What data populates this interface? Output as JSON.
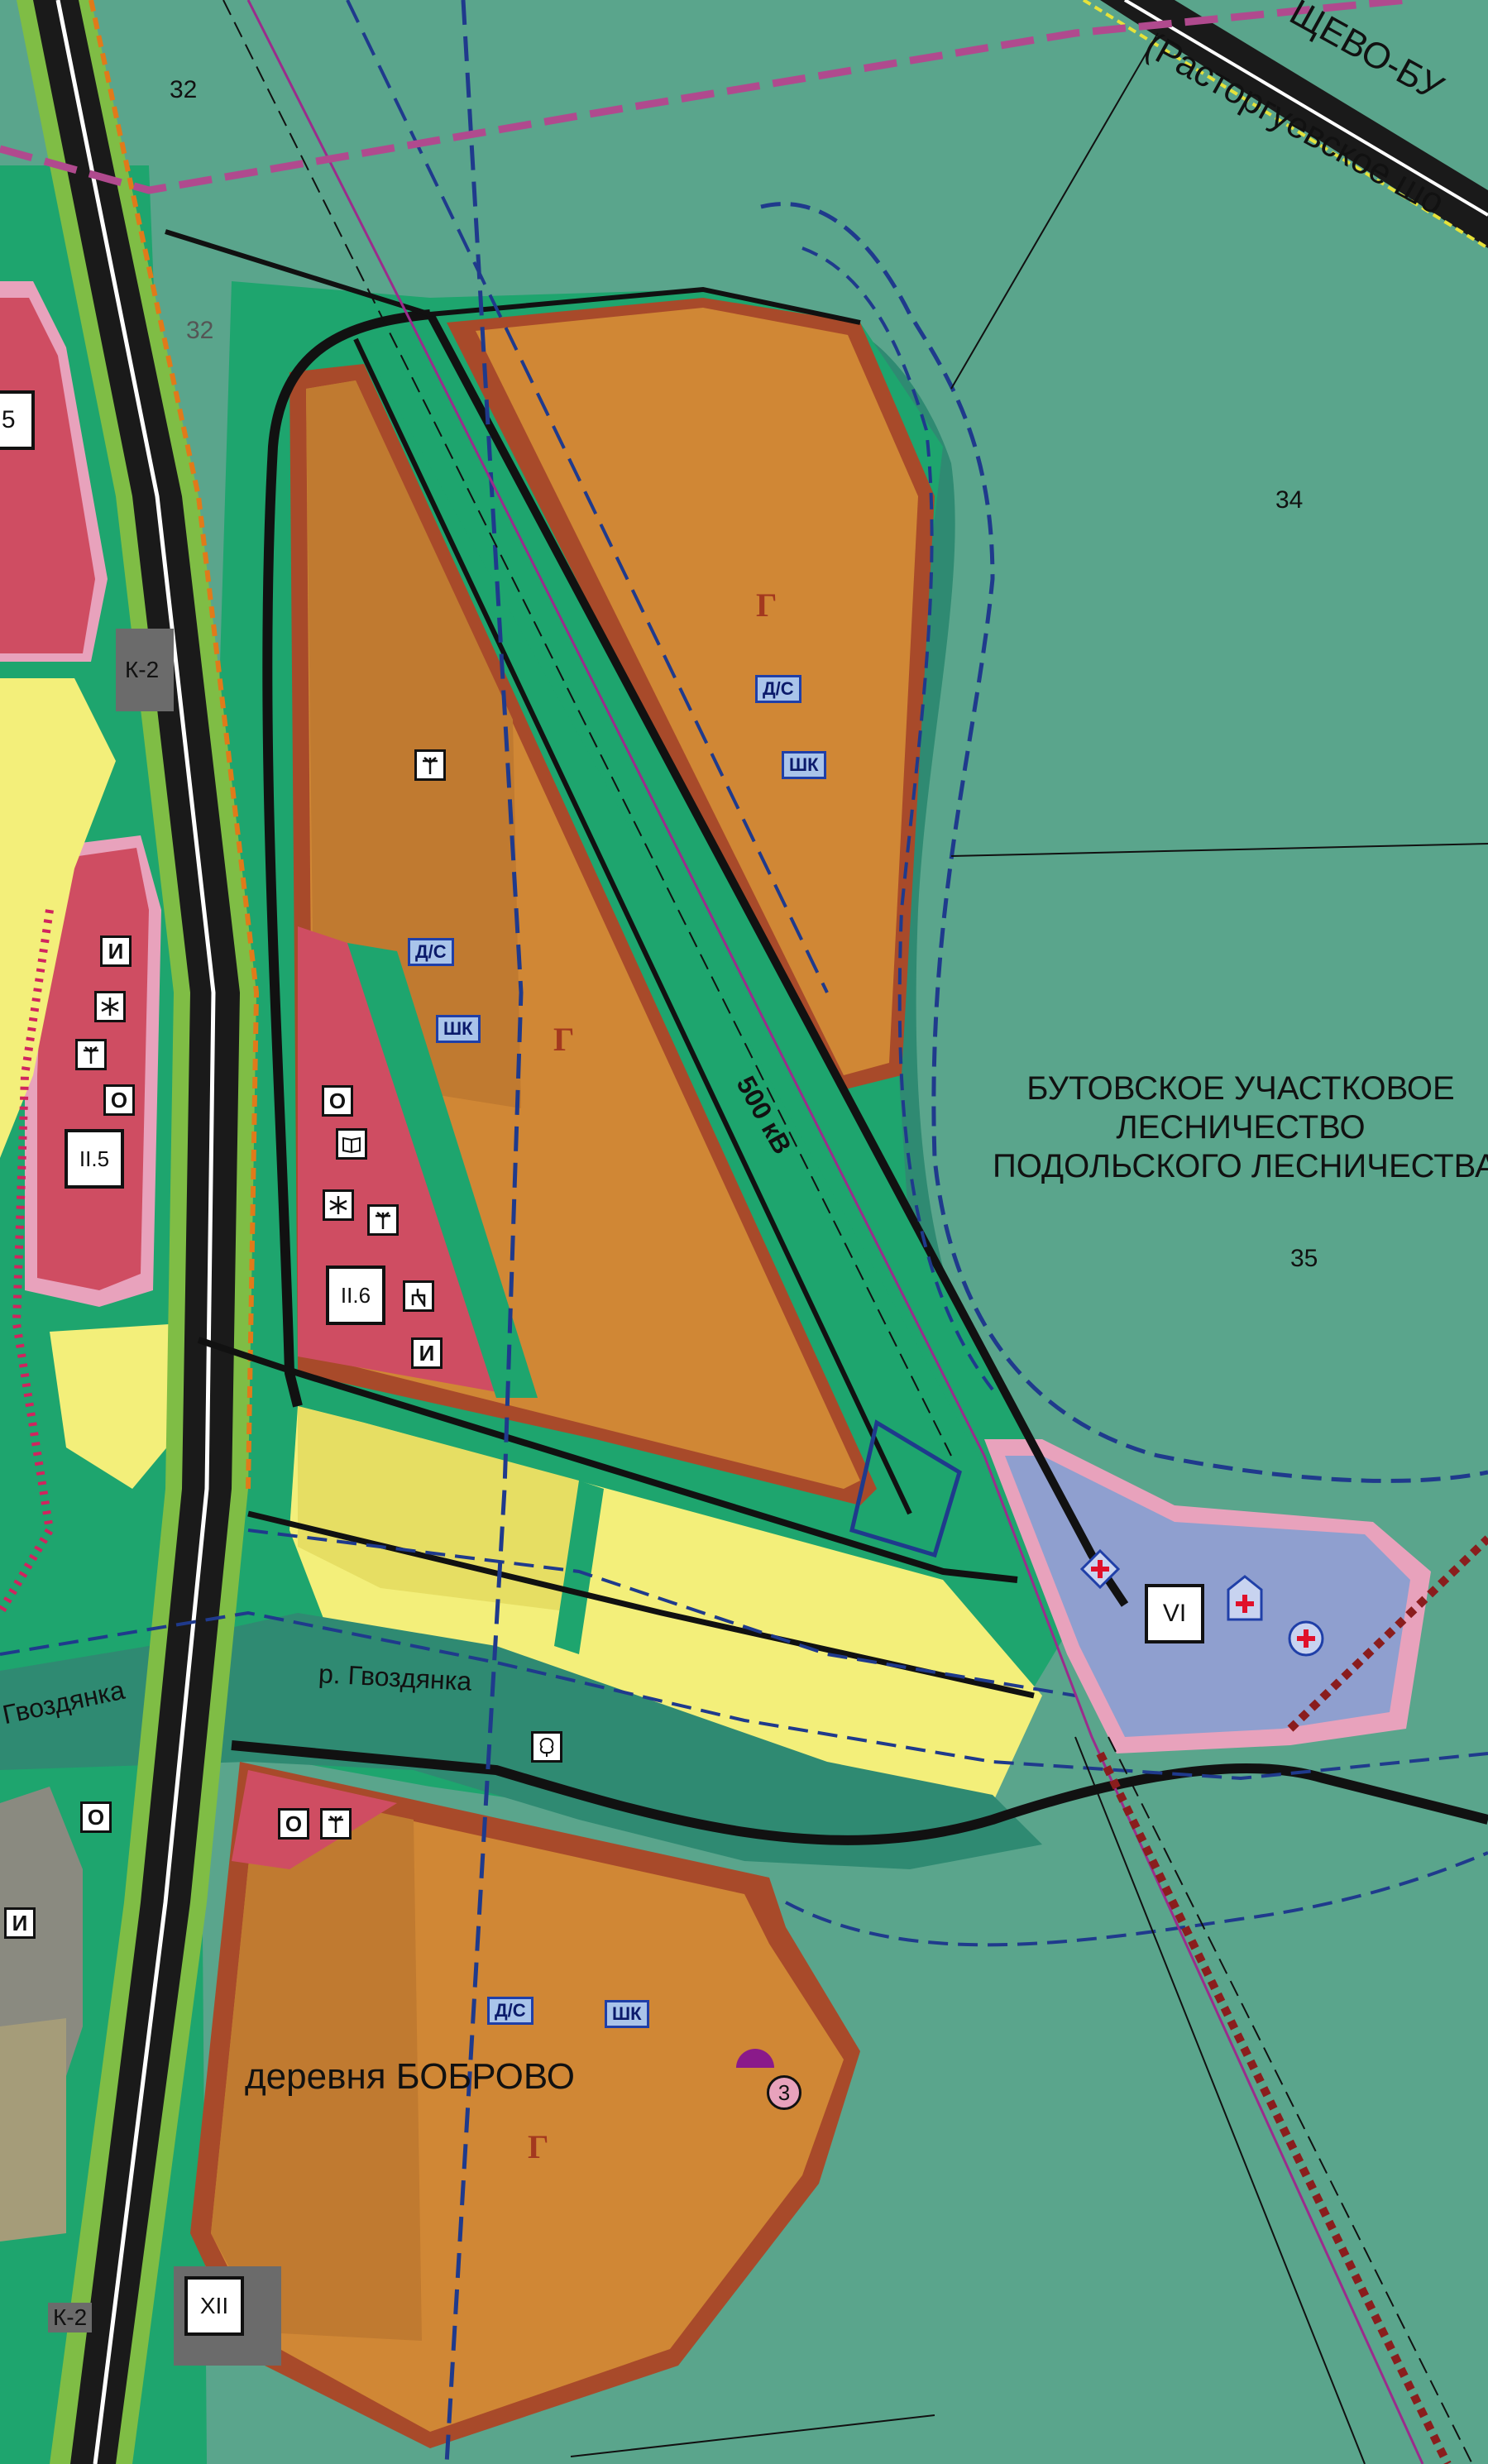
{
  "labels": {
    "num_32": "32",
    "num_34": "34",
    "num_35": "35",
    "num_32_faded": "32",
    "forestry_line1": "БУТОВСКОЕ УЧАСТКОВОЕ",
    "forestry_line2": "ЛЕСНИЧЕСТВО",
    "forestry_line3": "ПОДОЛЬСКОГО ЛЕСНИЧЕСТВА",
    "highway_top": "ЩЕВО-БУ",
    "highway_sub": "(Расторгуевское шо",
    "village": "деревня БОБРОВО",
    "river_main": "р. Гвоздянка",
    "river_left": "Гвоздянка",
    "powerline": "500 кВ"
  },
  "zone_letters": {
    "top_right": "Г",
    "middle": "Г",
    "bottom": "Г"
  },
  "codes": {
    "k2_top": "К-2",
    "k2_bottom": "К-2"
  },
  "blocks": {
    "ii5_left_edge": ".5",
    "ii5": "II.5",
    "ii6": "II.6",
    "vi": "VI",
    "xii": "XII"
  },
  "chips": {
    "ds_top": "Д/С",
    "shk_top": "ШК",
    "ds_mid": "Д/С",
    "shk_mid": "ШК",
    "ds_bot": "Д/С",
    "shk_bot": "ШК"
  },
  "small_symbols": {
    "i_left": "И",
    "o_left": "О",
    "o_mid": "О",
    "i_mid": "И",
    "o_bot_left": "О",
    "o_bot": "О",
    "i_bot_left": "И"
  },
  "badge_3": "3",
  "icons": [
    "tower-icon",
    "star-icon",
    "book-icon",
    "shop-icon",
    "tree-icon",
    "cross-icon",
    "church-icon",
    "dome-icon"
  ],
  "colors": {
    "forest": "#5aa58c",
    "green_belt": "#1ea56e",
    "orange_zone": "#d08735",
    "orange_border": "#a84a2a",
    "red_zone": "#cf4d62",
    "pink_border": "#e8a2bc",
    "yellow_zone": "#f3ef7a",
    "lavender_zone": "#8f9fcf",
    "road": "#1a1a1a",
    "blue_line": "#1f3a8c",
    "purple_line": "#9b2c8c"
  }
}
